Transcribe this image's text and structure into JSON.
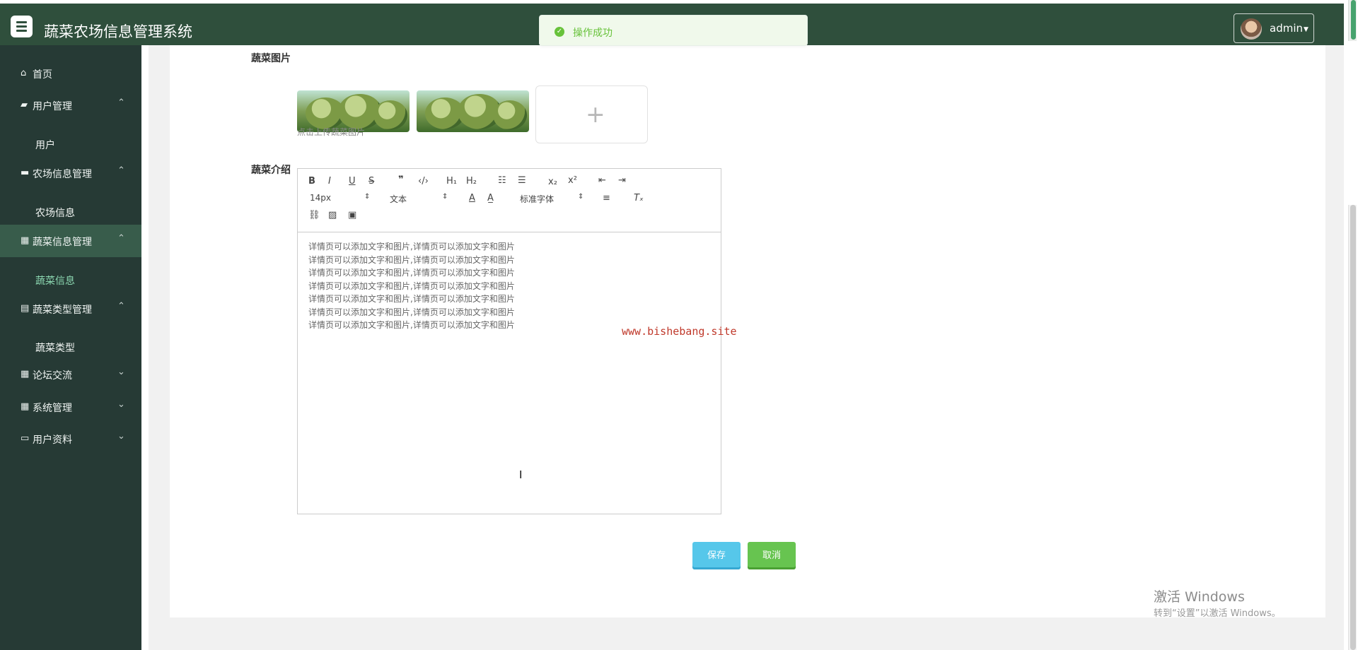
{
  "app": {
    "title": "蔬菜农场信息管理系统",
    "user": "admin"
  },
  "sidebar": {
    "items": [
      {
        "label": "首页",
        "icon": "home-icon"
      },
      {
        "label": "用户管理",
        "icon": "user-management-icon"
      },
      {
        "label": "用户",
        "icon": ""
      },
      {
        "label": "农场信息管理",
        "icon": "farm-icon"
      },
      {
        "label": "农场信息",
        "icon": ""
      },
      {
        "label": "蔬菜信息管理",
        "icon": "grid-icon"
      },
      {
        "label": "蔬菜信息",
        "icon": ""
      },
      {
        "label": "蔬菜类型管理",
        "icon": "bars-icon"
      },
      {
        "label": "蔬菜类型",
        "icon": ""
      },
      {
        "label": "论坛交流",
        "icon": "grid-icon"
      },
      {
        "label": "系统管理",
        "icon": "grid-icon"
      },
      {
        "label": "用户资料",
        "icon": "profile-icon"
      }
    ]
  },
  "toast": {
    "message": "操作成功"
  },
  "form": {
    "vegetable_image_label": "蔬菜图片",
    "upload_hint": "点击上传蔬菜图片",
    "intro_label": "蔬菜介绍",
    "editor_size": "14px",
    "editor_text_style": "文本",
    "editor_font": "标准字体",
    "editor_lines": [
      "详情页可以添加文字和图片,详情页可以添加文字和图片",
      "详情页可以添加文字和图片,详情页可以添加文字和图片",
      "详情页可以添加文字和图片,详情页可以添加文字和图片",
      "详情页可以添加文字和图片,详情页可以添加文字和图片",
      "详情页可以添加文字和图片,详情页可以添加文字和图片",
      "详情页可以添加文字和图片,详情页可以添加文字和图片",
      "详情页可以添加文字和图片,详情页可以添加文字和图片"
    ],
    "save": "保存",
    "cancel": "取消"
  },
  "watermark": "www.bishebang.site",
  "windows_notice": {
    "title": "激活 Windows",
    "subtitle": "转到“设置”以激活 Windows。"
  }
}
